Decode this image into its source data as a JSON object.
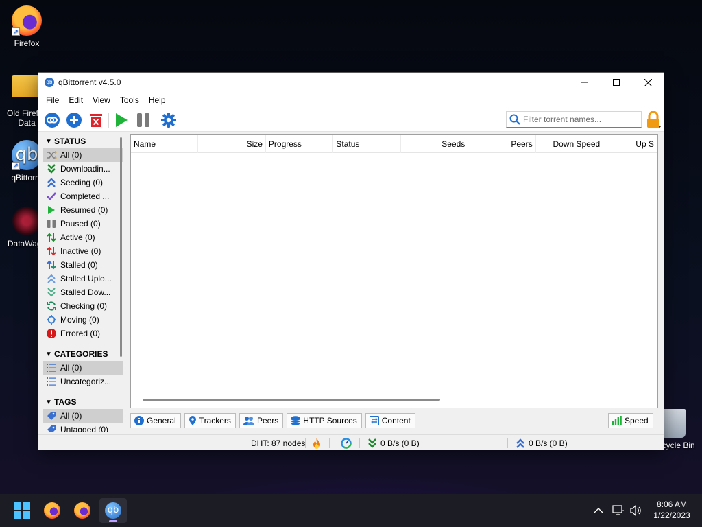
{
  "desktop": {
    "icons": [
      {
        "label": "Firefox"
      },
      {
        "label": "Old Firef…\nData"
      },
      {
        "label": "qBittorre"
      },
      {
        "label": "DataWago"
      }
    ],
    "recycle_bin": "Recycle Bin"
  },
  "window": {
    "title": "qBittorrent v4.5.0",
    "menu": [
      "File",
      "Edit",
      "View",
      "Tools",
      "Help"
    ],
    "search_placeholder": "Filter torrent names...",
    "sidebar": {
      "status_header": "STATUS",
      "status_items": [
        {
          "label": "All (0)",
          "icon": "shuffle-icon"
        },
        {
          "label": "Downloadin...",
          "icon": "download-icon"
        },
        {
          "label": "Seeding (0)",
          "icon": "seeding-icon"
        },
        {
          "label": "Completed ...",
          "icon": "check-icon"
        },
        {
          "label": "Resumed (0)",
          "icon": "play-icon"
        },
        {
          "label": "Paused (0)",
          "icon": "pause-icon"
        },
        {
          "label": "Active (0)",
          "icon": "active-icon"
        },
        {
          "label": "Inactive (0)",
          "icon": "inactive-icon"
        },
        {
          "label": "Stalled (0)",
          "icon": "stalled-icon"
        },
        {
          "label": "Stalled Uplo...",
          "icon": "stalled-upload-icon"
        },
        {
          "label": "Stalled Dow...",
          "icon": "stalled-download-icon"
        },
        {
          "label": "Checking (0)",
          "icon": "checking-icon"
        },
        {
          "label": "Moving (0)",
          "icon": "moving-icon"
        },
        {
          "label": "Errored (0)",
          "icon": "error-icon"
        }
      ],
      "categories_header": "CATEGORIES",
      "category_items": [
        {
          "label": "All (0)"
        },
        {
          "label": "Uncategoriz..."
        }
      ],
      "tags_header": "TAGS",
      "tag_items": [
        {
          "label": "All (0)"
        },
        {
          "label": "Untagged (0)"
        }
      ]
    },
    "columns": [
      "Name",
      "Size",
      "Progress",
      "Status",
      "Seeds",
      "Peers",
      "Down Speed",
      "Up S"
    ],
    "tabs": [
      "General",
      "Trackers",
      "Peers",
      "HTTP Sources",
      "Content"
    ],
    "speed_tab": "Speed",
    "status_bar": {
      "dht": "DHT: 87 nodes",
      "download": "0 B/s (0 B)",
      "upload": "0 B/s (0 B)"
    }
  },
  "taskbar": {
    "time": "8:06 AM",
    "date": "1/22/2023"
  }
}
